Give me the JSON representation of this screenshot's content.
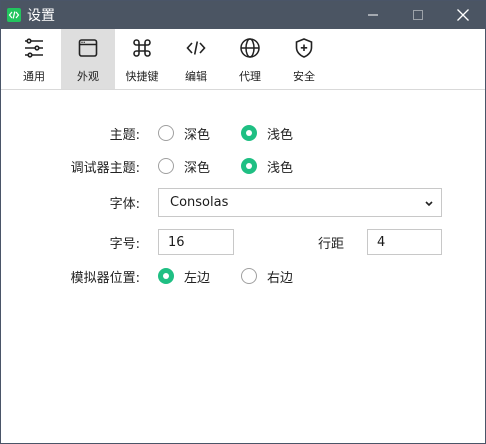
{
  "window": {
    "title": "设置"
  },
  "toolbar": {
    "items": [
      {
        "label": "通用",
        "icon": "sliders-icon"
      },
      {
        "label": "外观",
        "icon": "window-icon",
        "active": true
      },
      {
        "label": "快捷键",
        "icon": "command-icon"
      },
      {
        "label": "编辑",
        "icon": "code-icon"
      },
      {
        "label": "代理",
        "icon": "globe-icon"
      },
      {
        "label": "安全",
        "icon": "shield-plus-icon"
      }
    ]
  },
  "appearance": {
    "theme": {
      "label": "主题:",
      "options": [
        "深色",
        "浅色"
      ],
      "selected": "浅色"
    },
    "debugger_theme": {
      "label": "调试器主题:",
      "options": [
        "深色",
        "浅色"
      ],
      "selected": "浅色"
    },
    "font": {
      "label": "字体:",
      "value": "Consolas"
    },
    "font_size": {
      "label": "字号:",
      "value": "16"
    },
    "line_spacing": {
      "label": "行距",
      "value": "4"
    },
    "simulator_position": {
      "label": "模拟器位置:",
      "options": [
        "左边",
        "右边"
      ],
      "selected": "左边"
    }
  },
  "colors": {
    "accent": "#1fbf83",
    "titlebar": "#4b5563"
  }
}
